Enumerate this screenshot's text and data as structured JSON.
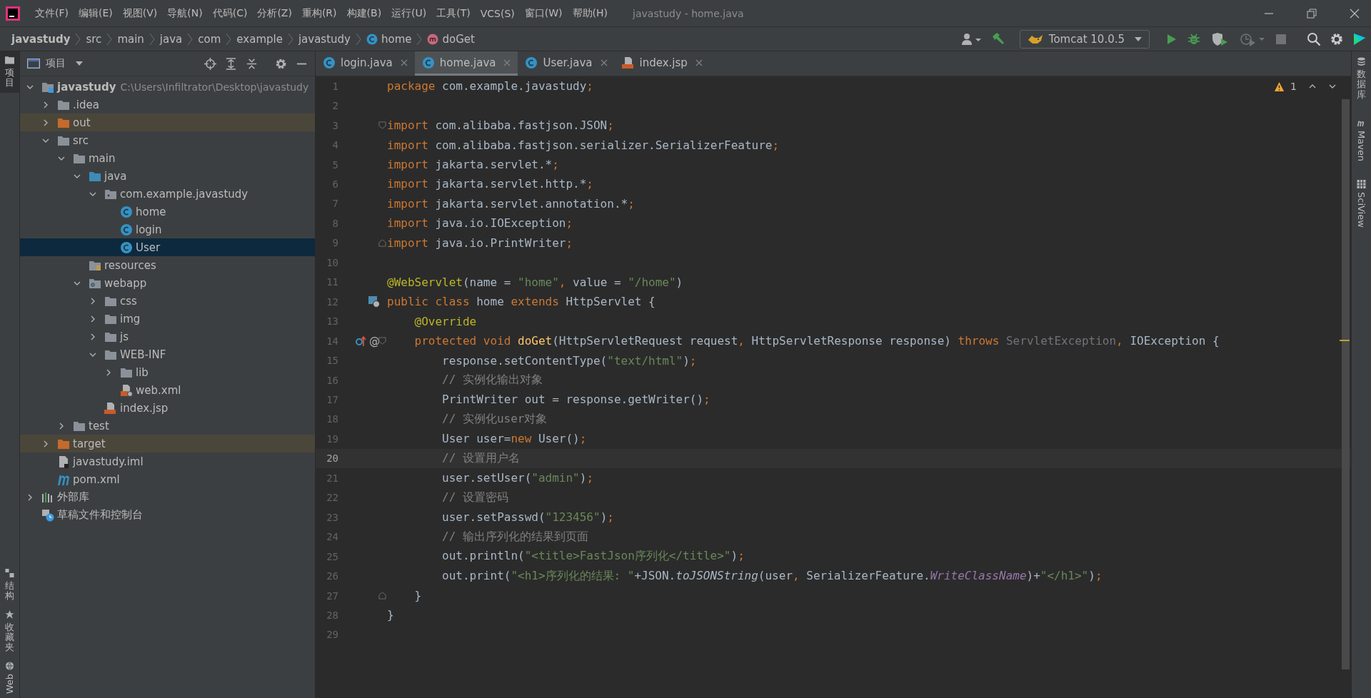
{
  "window": {
    "title": "javastudy - home.java"
  },
  "menu_bar": {
    "items": [
      "文件(F)",
      "编辑(E)",
      "视图(V)",
      "导航(N)",
      "代码(C)",
      "分析(Z)",
      "重构(R)",
      "构建(B)",
      "运行(U)",
      "工具(T)",
      "VCS(S)",
      "窗口(W)",
      "帮助(H)"
    ]
  },
  "navigation_bar": {
    "breadcrumbs": [
      {
        "text": "javastudy",
        "kind": "project"
      },
      {
        "text": "src",
        "kind": "folder"
      },
      {
        "text": "main",
        "kind": "folder"
      },
      {
        "text": "java",
        "kind": "folder"
      },
      {
        "text": "com",
        "kind": "folder"
      },
      {
        "text": "example",
        "kind": "folder"
      },
      {
        "text": "javastudy",
        "kind": "folder"
      },
      {
        "text": "home",
        "kind": "class"
      },
      {
        "text": "doGet",
        "kind": "method"
      }
    ],
    "toolbar_left": [
      {
        "kind": "vcs-user",
        "disabled": false
      },
      {
        "kind": "build",
        "disabled": false
      }
    ],
    "run_configuration": "Tomcat 10.0.5",
    "toolbar_right": [
      {
        "kind": "run",
        "disabled": false
      },
      {
        "kind": "debug",
        "disabled": false
      },
      {
        "kind": "coverage",
        "disabled": false
      },
      {
        "kind": "profile",
        "disabled": true
      },
      {
        "kind": "stop",
        "disabled": true
      },
      {
        "kind": "search",
        "disabled": false
      },
      {
        "kind": "settings",
        "disabled": false
      },
      {
        "kind": "toolbox",
        "disabled": false
      }
    ]
  },
  "left_tool_strip": {
    "top": [
      {
        "label": "项目",
        "kind": "project",
        "selected": true
      }
    ],
    "bottom": [
      {
        "label": "结构",
        "kind": "structure",
        "selected": false
      },
      {
        "label": "收藏夹",
        "kind": "favorites",
        "selected": false
      },
      {
        "label": "Web",
        "kind": "web",
        "selected": false
      }
    ]
  },
  "project_panel": {
    "title": "项目",
    "tree": [
      {
        "text": "javastudy",
        "path": "C:\\Users\\Infiltrator\\Desktop\\javastudy",
        "kind": "module",
        "expanded": true,
        "selected": false,
        "children": [
          {
            "text": ".idea",
            "kind": "folder",
            "expanded": false,
            "selected": false
          },
          {
            "text": "out",
            "kind": "excluded",
            "expanded": false,
            "selected": false
          },
          {
            "text": "src",
            "kind": "folder",
            "expanded": true,
            "selected": false,
            "children": [
              {
                "text": "main",
                "kind": "folder",
                "expanded": true,
                "selected": false,
                "children": [
                  {
                    "text": "java",
                    "kind": "source",
                    "expanded": true,
                    "selected": false,
                    "children": [
                      {
                        "text": "com.example.javastudy",
                        "kind": "package",
                        "expanded": true,
                        "selected": false,
                        "children": [
                          {
                            "text": "home",
                            "kind": "class",
                            "selected": false
                          },
                          {
                            "text": "login",
                            "kind": "class",
                            "selected": false
                          },
                          {
                            "text": "User",
                            "kind": "class",
                            "selected": true
                          }
                        ]
                      }
                    ]
                  },
                  {
                    "text": "resources",
                    "kind": "resources",
                    "selected": false
                  },
                  {
                    "text": "webapp",
                    "kind": "web",
                    "expanded": true,
                    "selected": false,
                    "children": [
                      {
                        "text": "css",
                        "kind": "folder",
                        "expanded": false,
                        "selected": false
                      },
                      {
                        "text": "img",
                        "kind": "folder",
                        "expanded": false,
                        "selected": false
                      },
                      {
                        "text": "js",
                        "kind": "folder",
                        "expanded": false,
                        "selected": false
                      },
                      {
                        "text": "WEB-INF",
                        "kind": "folder",
                        "expanded": true,
                        "selected": false,
                        "children": [
                          {
                            "text": "lib",
                            "kind": "folder",
                            "expanded": false,
                            "selected": false
                          },
                          {
                            "text": "web.xml",
                            "kind": "xml",
                            "selected": false
                          }
                        ]
                      },
                      {
                        "text": "index.jsp",
                        "kind": "jsp",
                        "selected": false
                      }
                    ]
                  }
                ]
              },
              {
                "text": "test",
                "kind": "folder",
                "expanded": false,
                "selected": false
              }
            ]
          },
          {
            "text": "target",
            "kind": "excluded",
            "expanded": false,
            "selected": false
          },
          {
            "text": "javastudy.iml",
            "kind": "iml",
            "selected": false
          },
          {
            "text": "pom.xml",
            "kind": "maven",
            "selected": false
          }
        ]
      },
      {
        "text": "外部库",
        "kind": "libraries",
        "expanded": false,
        "selected": false
      },
      {
        "text": "草稿文件和控制台",
        "kind": "scratches",
        "selected": false
      }
    ]
  },
  "editor": {
    "tabs": [
      {
        "label": "login.java",
        "kind": "class",
        "selected": false
      },
      {
        "label": "home.java",
        "kind": "class",
        "selected": true
      },
      {
        "label": "User.java",
        "kind": "class",
        "selected": false
      },
      {
        "label": "index.jsp",
        "kind": "jsp",
        "selected": false
      }
    ],
    "warning_count": "1",
    "lines": [
      {
        "number": "1",
        "current": false,
        "tokens": [
          {
            "kind": "kw",
            "text": "package"
          },
          {
            "kind": "plain",
            "text": " com.example.javastudy"
          },
          {
            "kind": "kw",
            "text": ";"
          }
        ]
      },
      {
        "number": "2",
        "current": false
      },
      {
        "number": "3",
        "current": false,
        "fold": {
          "kind": "start"
        },
        "tokens": [
          {
            "kind": "kw",
            "text": "import"
          },
          {
            "kind": "plain",
            "text": " com.alibaba.fastjson.JSON"
          },
          {
            "kind": "kw",
            "text": ";"
          }
        ]
      },
      {
        "number": "4",
        "current": false,
        "tokens": [
          {
            "kind": "kw",
            "text": "import"
          },
          {
            "kind": "plain",
            "text": " com.alibaba.fastjson.serializer.SerializerFeature"
          },
          {
            "kind": "kw",
            "text": ";"
          }
        ]
      },
      {
        "number": "5",
        "current": false,
        "tokens": [
          {
            "kind": "kw",
            "text": "import"
          },
          {
            "kind": "plain",
            "text": " jakarta.servlet.*"
          },
          {
            "kind": "kw",
            "text": ";"
          }
        ]
      },
      {
        "number": "6",
        "current": false,
        "tokens": [
          {
            "kind": "kw",
            "text": "import"
          },
          {
            "kind": "plain",
            "text": " jakarta.servlet.http.*"
          },
          {
            "kind": "kw",
            "text": ";"
          }
        ]
      },
      {
        "number": "7",
        "current": false,
        "tokens": [
          {
            "kind": "kw",
            "text": "import"
          },
          {
            "kind": "plain",
            "text": " jakarta.servlet.annotation.*"
          },
          {
            "kind": "kw",
            "text": ";"
          }
        ]
      },
      {
        "number": "8",
        "current": false,
        "tokens": [
          {
            "kind": "kw",
            "text": "import"
          },
          {
            "kind": "plain",
            "text": " java.io.IOException"
          },
          {
            "kind": "kw",
            "text": ";"
          }
        ]
      },
      {
        "number": "9",
        "current": false,
        "fold": {
          "kind": "end"
        },
        "tokens": [
          {
            "kind": "kw",
            "text": "import"
          },
          {
            "kind": "plain",
            "text": " java.io.PrintWriter"
          },
          {
            "kind": "kw",
            "text": ";"
          }
        ]
      },
      {
        "number": "10",
        "current": false
      },
      {
        "number": "11",
        "current": false,
        "tokens": [
          {
            "kind": "annotation",
            "text": "@WebServlet"
          },
          {
            "kind": "plain",
            "text": "(name = "
          },
          {
            "kind": "string",
            "text": "\"home\""
          },
          {
            "kind": "kw",
            "text": ", "
          },
          {
            "kind": "plain",
            "text": "value = "
          },
          {
            "kind": "string",
            "text": "\"/home\""
          },
          {
            "kind": "plain",
            "text": ")"
          }
        ]
      },
      {
        "number": "12",
        "current": false,
        "gutter_icons": [
          {
            "kind": "servlet"
          }
        ],
        "tokens": [
          {
            "kind": "kw",
            "text": "public class "
          },
          {
            "kind": "plain",
            "text": "home "
          },
          {
            "kind": "kw",
            "text": "extends "
          },
          {
            "kind": "plain",
            "text": "HttpServlet {"
          }
        ]
      },
      {
        "number": "13",
        "current": false,
        "tokens": [
          {
            "kind": "annotation",
            "text": "    @Override"
          }
        ]
      },
      {
        "number": "14",
        "current": false,
        "gutter_icons": [
          {
            "kind": "overriding"
          }
        ],
        "gutter_text": "@",
        "fold": {
          "kind": "start"
        },
        "tokens": [
          {
            "kind": "kw",
            "text": "    protected void "
          },
          {
            "kind": "method",
            "text": "doGet"
          },
          {
            "kind": "plain",
            "text": "(HttpServletRequest request"
          },
          {
            "kind": "kw",
            "text": ", "
          },
          {
            "kind": "plain",
            "text": "HttpServletResponse response) "
          },
          {
            "kind": "kw",
            "text": "throws "
          },
          {
            "kind": "unused",
            "text": "ServletException"
          },
          {
            "kind": "kw",
            "text": ", "
          },
          {
            "kind": "plain",
            "text": "IOException {"
          }
        ]
      },
      {
        "number": "15",
        "current": false,
        "tokens": [
          {
            "kind": "plain",
            "text": "        response.setContentType("
          },
          {
            "kind": "string",
            "text": "\"text/html\""
          },
          {
            "kind": "plain",
            "text": ")"
          },
          {
            "kind": "kw",
            "text": ";"
          }
        ]
      },
      {
        "number": "16",
        "current": false,
        "tokens": [
          {
            "kind": "comment",
            "text": "        // 实例化输出对象"
          }
        ]
      },
      {
        "number": "17",
        "current": false,
        "tokens": [
          {
            "kind": "plain",
            "text": "        PrintWriter out = response.getWriter()"
          },
          {
            "kind": "kw",
            "text": ";"
          }
        ]
      },
      {
        "number": "18",
        "current": false,
        "tokens": [
          {
            "kind": "comment",
            "text": "        // 实例化user对象"
          }
        ]
      },
      {
        "number": "19",
        "current": false,
        "tokens": [
          {
            "kind": "plain",
            "text": "        User user="
          },
          {
            "kind": "kw",
            "text": "new "
          },
          {
            "kind": "plain",
            "text": "User()"
          },
          {
            "kind": "kw",
            "text": ";"
          }
        ]
      },
      {
        "number": "20",
        "current": true,
        "tokens": [
          {
            "kind": "comment",
            "text": "        // 设置用户名"
          }
        ]
      },
      {
        "number": "21",
        "current": false,
        "tokens": [
          {
            "kind": "plain",
            "text": "        user.setUser("
          },
          {
            "kind": "string",
            "text": "\"admin\""
          },
          {
            "kind": "plain",
            "text": ")"
          },
          {
            "kind": "kw",
            "text": ";"
          }
        ]
      },
      {
        "number": "22",
        "current": false,
        "tokens": [
          {
            "kind": "comment",
            "text": "        // 设置密码"
          }
        ]
      },
      {
        "number": "23",
        "current": false,
        "tokens": [
          {
            "kind": "plain",
            "text": "        user.setPasswd("
          },
          {
            "kind": "string",
            "text": "\"123456\""
          },
          {
            "kind": "plain",
            "text": ")"
          },
          {
            "kind": "kw",
            "text": ";"
          }
        ]
      },
      {
        "number": "24",
        "current": false,
        "tokens": [
          {
            "kind": "comment",
            "text": "        // 输出序列化的结果到页面"
          }
        ]
      },
      {
        "number": "25",
        "current": false,
        "tokens": [
          {
            "kind": "plain",
            "text": "        out.println("
          },
          {
            "kind": "string",
            "text": "\"<title>FastJson序列化</title>\""
          },
          {
            "kind": "plain",
            "text": ")"
          },
          {
            "kind": "kw",
            "text": ";"
          }
        ]
      },
      {
        "number": "26",
        "current": false,
        "tokens": [
          {
            "kind": "plain",
            "text": "        out.print("
          },
          {
            "kind": "string",
            "text": "\"<h1>序列化的结果: \""
          },
          {
            "kind": "plain",
            "text": "+JSON."
          },
          {
            "kind": "static",
            "text": "toJSONString"
          },
          {
            "kind": "plain",
            "text": "(user"
          },
          {
            "kind": "kw",
            "text": ", "
          },
          {
            "kind": "plain",
            "text": "SerializerFeature."
          },
          {
            "kind": "field",
            "text": "WriteClassName"
          },
          {
            "kind": "plain",
            "text": ")+"
          },
          {
            "kind": "string",
            "text": "\"</h1>\""
          },
          {
            "kind": "plain",
            "text": ")"
          },
          {
            "kind": "kw",
            "text": ";"
          }
        ]
      },
      {
        "number": "27",
        "current": false,
        "fold": {
          "kind": "end"
        },
        "tokens": [
          {
            "kind": "plain",
            "text": "    }"
          }
        ]
      },
      {
        "number": "28",
        "current": false,
        "tokens": [
          {
            "kind": "plain",
            "text": "}"
          }
        ]
      },
      {
        "number": "29",
        "current": false
      }
    ]
  },
  "right_tool_strip": {
    "items": [
      {
        "label": "数据库",
        "kind": "database",
        "selected": false
      },
      {
        "label": "Maven",
        "kind": "maven",
        "selected": false
      },
      {
        "label": "SciView",
        "kind": "sciview",
        "selected": false
      }
    ]
  }
}
